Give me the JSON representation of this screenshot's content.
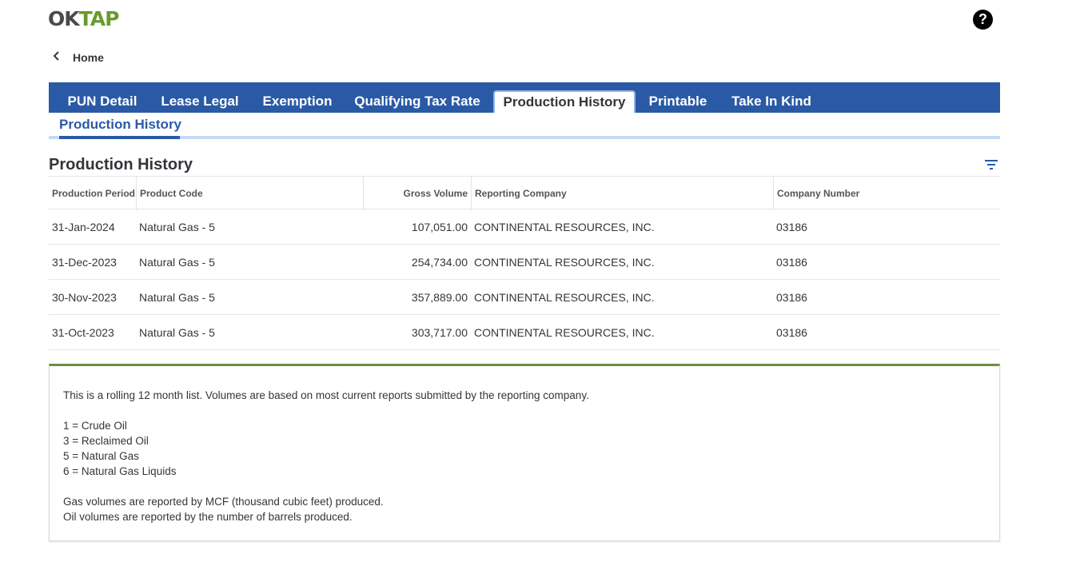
{
  "app": {
    "logo_ok": "OK",
    "logo_tap": "TAP",
    "help_glyph": "?"
  },
  "nav": {
    "back_label": "Home",
    "back_icon": "chevron-left-icon"
  },
  "tabs": [
    {
      "label": "PUN Detail",
      "active": false
    },
    {
      "label": "Lease Legal",
      "active": false
    },
    {
      "label": "Exemption",
      "active": false
    },
    {
      "label": "Qualifying Tax Rate",
      "active": false
    },
    {
      "label": "Production History",
      "active": true
    },
    {
      "label": "Printable",
      "active": false
    },
    {
      "label": "Take In Kind",
      "active": false
    }
  ],
  "subtab": {
    "label": "Production History"
  },
  "section": {
    "title": "Production History",
    "filter_icon": "filter-icon"
  },
  "table": {
    "columns": [
      "Production Period",
      "Product Code",
      "Gross Volume",
      "Reporting Company",
      "Company Number"
    ],
    "rows": [
      [
        "31-Jan-2024",
        "Natural Gas - 5",
        "107,051.00",
        "CONTINENTAL RESOURCES, INC.",
        "03186"
      ],
      [
        "31-Dec-2023",
        "Natural Gas - 5",
        "254,734.00",
        "CONTINENTAL RESOURCES, INC.",
        "03186"
      ],
      [
        "30-Nov-2023",
        "Natural Gas - 5",
        "357,889.00",
        "CONTINENTAL RESOURCES, INC.",
        "03186"
      ],
      [
        "31-Oct-2023",
        "Natural Gas - 5",
        "303,717.00",
        "CONTINENTAL RESOURCES, INC.",
        "03186"
      ]
    ]
  },
  "notes": {
    "intro": "This is a rolling 12 month list. Volumes are based on most current reports submitted by the reporting company.",
    "codes": [
      "1 = Crude Oil",
      "3 = Reclaimed Oil",
      "5 = Natural Gas",
      "6 = Natural Gas Liquids"
    ],
    "units": [
      "Gas volumes are reported by MCF (thousand cubic feet) produced.",
      "Oil volumes are reported by the number of barrels produced."
    ]
  },
  "colors": {
    "brand_blue": "#2a5aa6",
    "brand_green": "#6a9a2c",
    "note_border": "#6e8f3e"
  }
}
